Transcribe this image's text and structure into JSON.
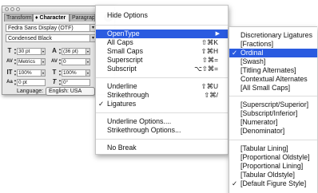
{
  "palette": {
    "tabs": [
      "Transform",
      "♦ Character",
      "Paragraph"
    ],
    "menu_button_icon": "▶",
    "font_family": "Fedra Sans Display (OTF)",
    "font_style": "Condensed Black",
    "font_size": "30 pt",
    "leading": "(36 pt)",
    "kerning": "Metrics",
    "tracking": "0",
    "vertical_scale": "100%",
    "horizontal_scale": "100%",
    "baseline_shift": "0 pt",
    "skew": "0°",
    "language_label": "Language:",
    "language_value": "English: USA"
  },
  "main_menu": {
    "hide_options": "Hide Options",
    "items": [
      {
        "label": "OpenType",
        "shortcut": "▶"
      },
      {
        "label": "All Caps",
        "shortcut": "⇧⌘K"
      },
      {
        "label": "Small Caps",
        "shortcut": "⇧⌘H"
      },
      {
        "label": "Superscript",
        "shortcut": "⇧⌘="
      },
      {
        "label": "Subscript",
        "shortcut": "⌥⇧⌘="
      },
      {
        "label": "Underline",
        "shortcut": "⇧⌘U"
      },
      {
        "label": "Strikethrough",
        "shortcut": "⇧⌘/"
      },
      {
        "label": "Ligatures",
        "shortcut": ""
      },
      {
        "label": "Underline Options....",
        "shortcut": ""
      },
      {
        "label": "Strikethrough Options...",
        "shortcut": ""
      },
      {
        "label": "No Break",
        "shortcut": ""
      }
    ]
  },
  "submenu": {
    "items": [
      "Discretionary Ligatures",
      "[Fractions]",
      "Ordinal",
      "[Swash]",
      "[Titling Alternates]",
      "Contextual Alternates",
      "[All Small Caps]",
      "[Superscript/Superior]",
      "[Subscript/Inferior]",
      "[Numerator]",
      "[Denominator]",
      "[Tabular Lining]",
      "[Proportional Oldstyle]",
      "[Proportional Lining]",
      "[Tabular Oldstyle]",
      "[Default Figure Style]"
    ]
  },
  "check_glyph": "✓",
  "colors": {
    "highlight": "#2a5be0"
  }
}
